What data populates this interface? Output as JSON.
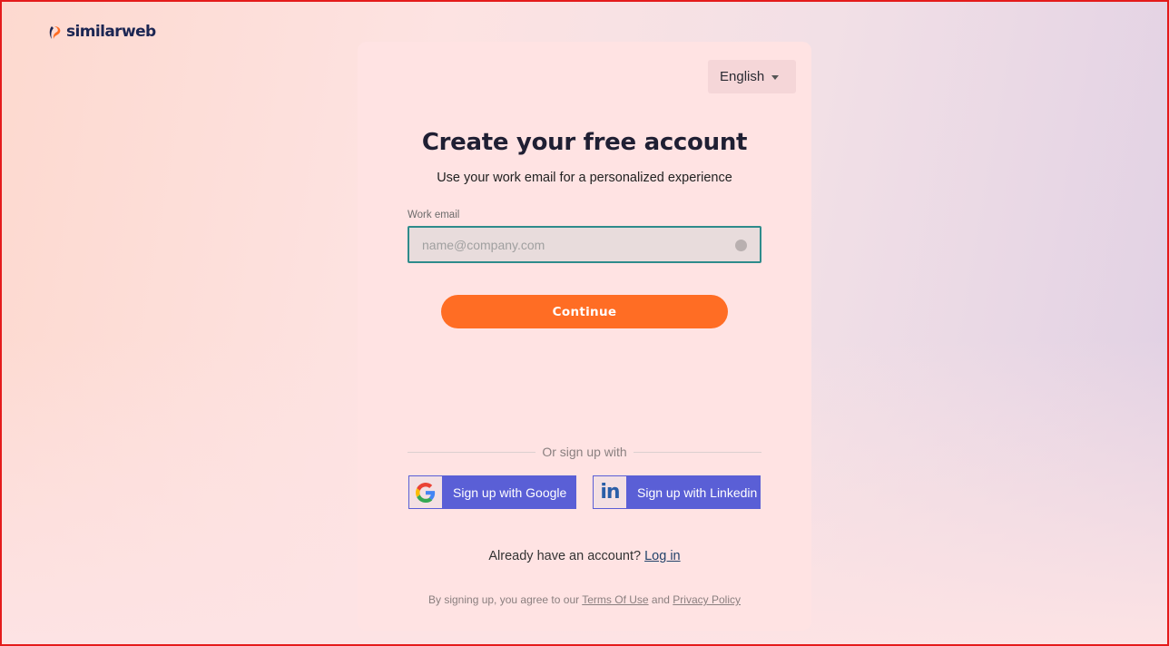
{
  "logo": {
    "text": "similarweb",
    "icon": "similarweb-logo-icon"
  },
  "language": {
    "selected": "English",
    "icon": "chevron-down-icon"
  },
  "form": {
    "title": "Create your free account",
    "subtitle": "Use your work email for a personalized experience",
    "email_label": "Work email",
    "email_placeholder": "name@company.com",
    "email_value": "",
    "continue_label": "Continue"
  },
  "divider_text": "Or sign up with",
  "social": {
    "google_label": "Sign up with Google",
    "google_icon": "google-icon",
    "linkedin_label": "Sign up with Linkedin",
    "linkedin_icon": "linkedin-icon",
    "linkedin_mark": "in"
  },
  "login": {
    "prompt": "Already have an account?",
    "link": "Log in"
  },
  "legal": {
    "prefix": "By signing up, you agree to our",
    "terms": "Terms Of Use",
    "joiner": "and",
    "privacy": "Privacy Policy"
  },
  "colors": {
    "accent": "#ff6d24",
    "social_button": "#5a5fd6",
    "input_border": "#2e8b8b",
    "brand_text": "#1b2653"
  }
}
